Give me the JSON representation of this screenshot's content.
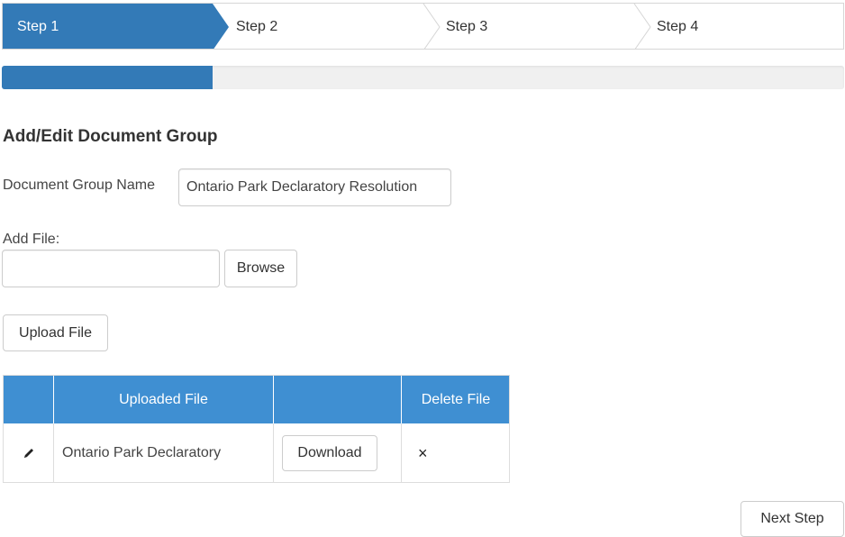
{
  "wizard": {
    "steps": [
      {
        "label": "Step 1",
        "active": true
      },
      {
        "label": "Step 2",
        "active": false
      },
      {
        "label": "Step 3",
        "active": false
      },
      {
        "label": "Step 4",
        "active": false
      }
    ]
  },
  "progress": {
    "value_fraction": 0.25
  },
  "form": {
    "heading": "Add/Edit Document Group",
    "group_name_label": "Document Group Name",
    "group_name_value": "Ontario Park Declaratory Resolution",
    "add_file_label": "Add File:",
    "file_input_value": "",
    "browse_label": "Browse",
    "upload_label": "Upload File"
  },
  "table": {
    "headers": [
      "",
      "Uploaded File",
      "",
      "Delete File"
    ],
    "rows": [
      {
        "edit_icon": "pencil-icon",
        "file_name": "Ontario Park Declaratory",
        "download_label": "Download",
        "delete_icon": "×"
      }
    ]
  },
  "footer": {
    "next_label": "Next Step"
  },
  "colors": {
    "accent": "#337ab7",
    "table_header": "#3f8fd2",
    "progress_track": "#f0f0f0"
  }
}
